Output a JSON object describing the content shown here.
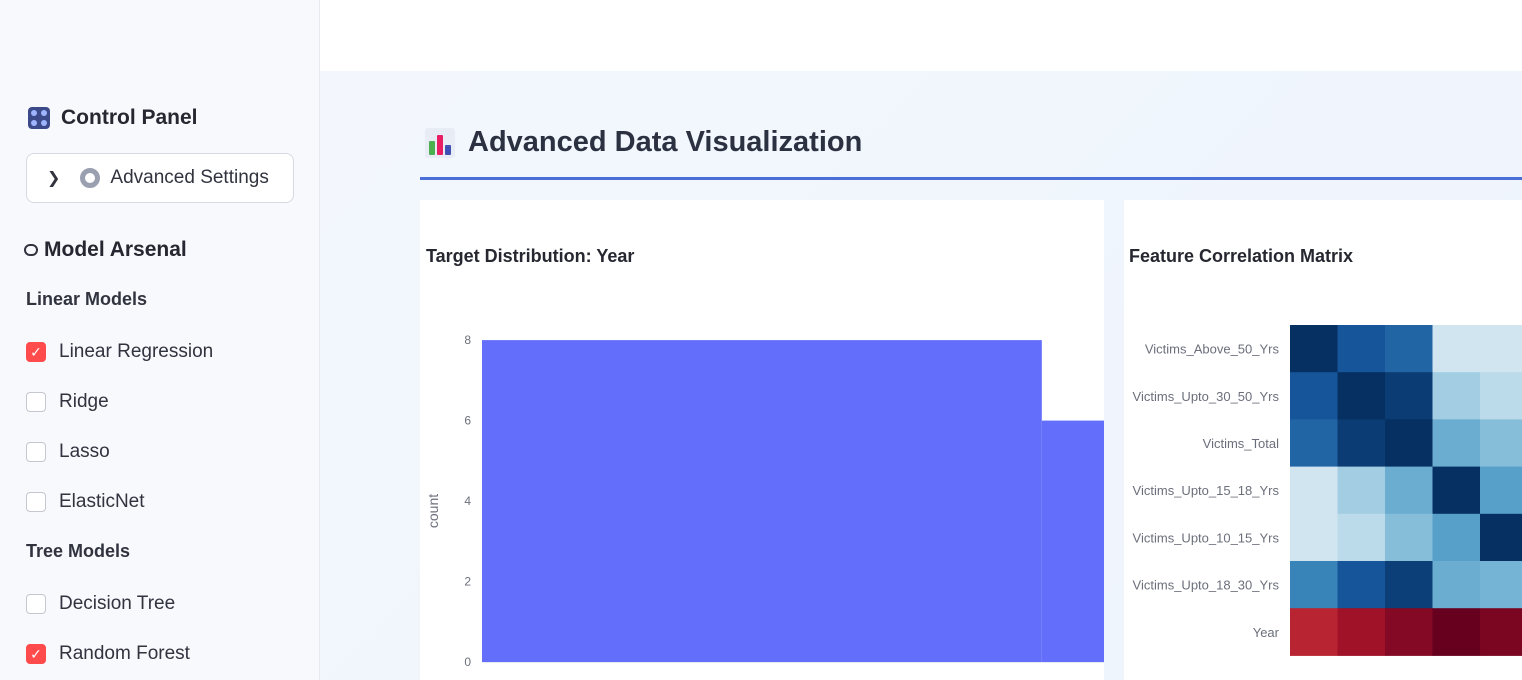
{
  "sidebar": {
    "title": "Control Panel",
    "expander_label": "Advanced Settings",
    "section_title": "Model Arsenal",
    "groups": [
      {
        "label": "Linear Models",
        "items": [
          {
            "label": "Linear Regression",
            "checked": true
          },
          {
            "label": "Ridge",
            "checked": false
          },
          {
            "label": "Lasso",
            "checked": false
          },
          {
            "label": "ElasticNet",
            "checked": false
          }
        ]
      },
      {
        "label": "Tree Models",
        "items": [
          {
            "label": "Decision Tree",
            "checked": false
          },
          {
            "label": "Random Forest",
            "checked": true
          }
        ]
      }
    ]
  },
  "main": {
    "title": "Advanced Data Visualization",
    "cards": [
      {
        "title": "Target Distribution: Year"
      },
      {
        "title": "Feature Correlation Matrix"
      }
    ]
  },
  "colors": {
    "accent": "#4a6fd6",
    "checkbox_checked": "#ff4b4b",
    "bar": "#636efa"
  },
  "chart_data": [
    {
      "type": "bar",
      "title": "Target Distribution: Year",
      "ylabel": "count",
      "ylim": [
        0,
        8.5
      ],
      "yticks": [
        "0",
        "2",
        "4",
        "6",
        "8"
      ],
      "bins": [
        {
          "start": 0.0,
          "end": 0.9,
          "value": 8
        },
        {
          "start": 0.9,
          "end": 1.0,
          "value": 6
        }
      ]
    },
    {
      "type": "heatmap",
      "title": "Feature Correlation Matrix",
      "rows": [
        "Victims_Above_50_Yrs",
        "Victims_Upto_30_50_Yrs",
        "Victims_Total",
        "Victims_Upto_15_18_Yrs",
        "Victims_Upto_10_15_Yrs",
        "Victims_Upto_18_30_Yrs",
        "Year"
      ],
      "values": [
        [
          1.0,
          0.75,
          0.7,
          0.15,
          0.15
        ],
        [
          0.75,
          1.0,
          0.92,
          0.3,
          0.22
        ],
        [
          0.7,
          0.92,
          1.0,
          0.45,
          0.38
        ],
        [
          0.15,
          0.3,
          0.45,
          1.0,
          0.5
        ],
        [
          0.15,
          0.22,
          0.38,
          0.5,
          1.0
        ],
        [
          0.6,
          0.75,
          0.9,
          0.45,
          0.42
        ],
        [
          -0.55,
          -0.7,
          -0.85,
          -1.0,
          -0.9
        ]
      ]
    }
  ]
}
